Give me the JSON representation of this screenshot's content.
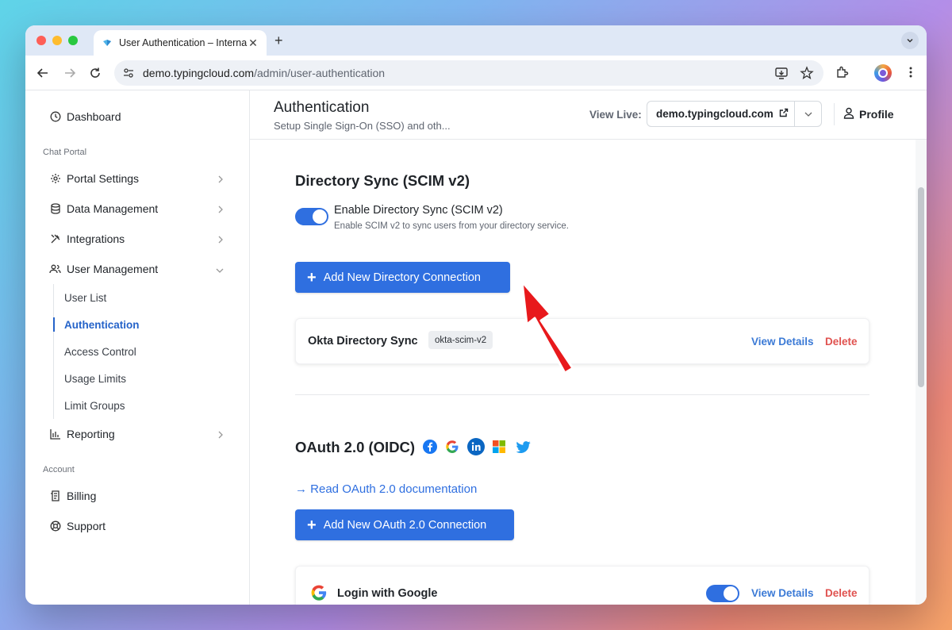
{
  "browser": {
    "tab_title": "User Authentication – Internal",
    "url_domain": "demo.typingcloud.com",
    "url_path": "/admin/user-authentication"
  },
  "sidebar": {
    "top_item": "Dashboard",
    "section_chat": "Chat Portal",
    "items": [
      {
        "label": "Portal Settings",
        "icon": "gear-icon"
      },
      {
        "label": "Data Management",
        "icon": "database-icon"
      },
      {
        "label": "Integrations",
        "icon": "tools-icon"
      },
      {
        "label": "User Management",
        "icon": "users-icon"
      }
    ],
    "sub_items": [
      "User List",
      "Authentication",
      "Access Control",
      "Usage Limits",
      "Limit Groups"
    ],
    "reporting": "Reporting",
    "section_account": "Account",
    "account_items": [
      "Billing",
      "Support"
    ]
  },
  "header": {
    "title": "Authentication",
    "subtitle": "Setup Single Sign-On (SSO) and oth...",
    "view_live_label": "View Live:",
    "live_domain": "demo.typingcloud.com",
    "profile": "Profile"
  },
  "directory_sync": {
    "title": "Directory Sync (SCIM v2)",
    "toggle_label": "Enable Directory Sync (SCIM v2)",
    "toggle_desc": "Enable SCIM v2 to sync users from your directory service.",
    "toggle_on": true,
    "add_button": "Add New Directory Connection",
    "connection": {
      "name": "Okta Directory Sync",
      "badge": "okta-scim-v2",
      "view": "View Details",
      "delete": "Delete"
    }
  },
  "oauth": {
    "title": "OAuth 2.0 (OIDC)",
    "providers": [
      "facebook-icon",
      "google-icon",
      "linkedin-icon",
      "microsoft-icon",
      "twitter-icon"
    ],
    "doc_link": "→ Read OAuth 2.0 documentation",
    "add_button": "Add New OAuth 2.0 Connection",
    "connection": {
      "name": "Login with Google",
      "enabled": true,
      "view": "View Details",
      "delete": "Delete"
    }
  },
  "colors": {
    "accent": "#2f6fe0",
    "danger": "#e0524f",
    "annotation_arrow": "#e8191c"
  }
}
